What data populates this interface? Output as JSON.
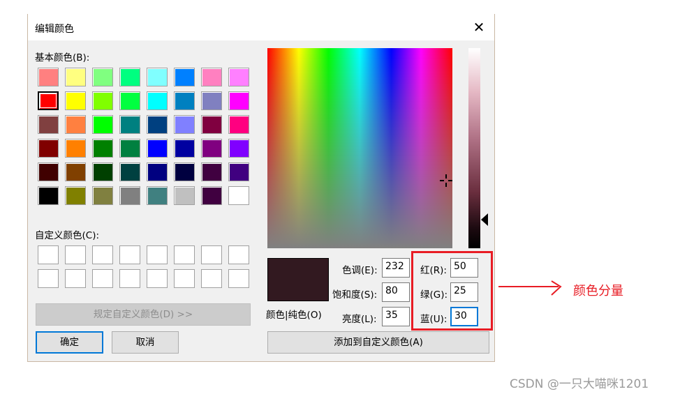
{
  "dialog": {
    "title": "编辑颜色",
    "basic_label": "基本颜色(B):",
    "custom_label": "自定义颜色(C):",
    "define_custom_button": "规定自定义颜色(D) >>",
    "ok_button": "确定",
    "cancel_button": "取消",
    "add_custom_button": "添加到自定义颜色(A)",
    "preview_label": "颜色|纯色(O)",
    "preview_color": "#321920",
    "hue_label": "色调(E):",
    "hue_value": "232",
    "sat_label": "饱和度(S):",
    "sat_value": "80",
    "lum_label": "亮度(L):",
    "lum_value": "35",
    "red_label": "红(R):",
    "red_value": "50",
    "green_label": "绿(G):",
    "green_value": "25",
    "blue_label": "蓝(U):",
    "blue_value": "30",
    "close_icon": "close-icon"
  },
  "basic_colors": [
    [
      "#ff8080",
      "#ffff80",
      "#80ff80",
      "#00ff80",
      "#80ffff",
      "#0080ff",
      "#ff80c0",
      "#ff80ff"
    ],
    [
      "#ff0000",
      "#ffff00",
      "#80ff00",
      "#00ff40",
      "#00ffff",
      "#0080c0",
      "#8080c0",
      "#ff00ff"
    ],
    [
      "#804040",
      "#ff8040",
      "#00ff00",
      "#008080",
      "#004080",
      "#8080ff",
      "#800040",
      "#ff0080"
    ],
    [
      "#800000",
      "#ff8000",
      "#008000",
      "#008040",
      "#0000ff",
      "#0000a0",
      "#800080",
      "#8000ff"
    ],
    [
      "#400000",
      "#804000",
      "#004000",
      "#004040",
      "#000080",
      "#000040",
      "#400040",
      "#400080"
    ],
    [
      "#000000",
      "#808000",
      "#808040",
      "#808080",
      "#408080",
      "#c0c0c0",
      "#400040",
      "#ffffff"
    ]
  ],
  "annotation": {
    "label": "颜色分量",
    "color": "#e81c24"
  },
  "watermark": "CSDN @一只大喵咪1201"
}
